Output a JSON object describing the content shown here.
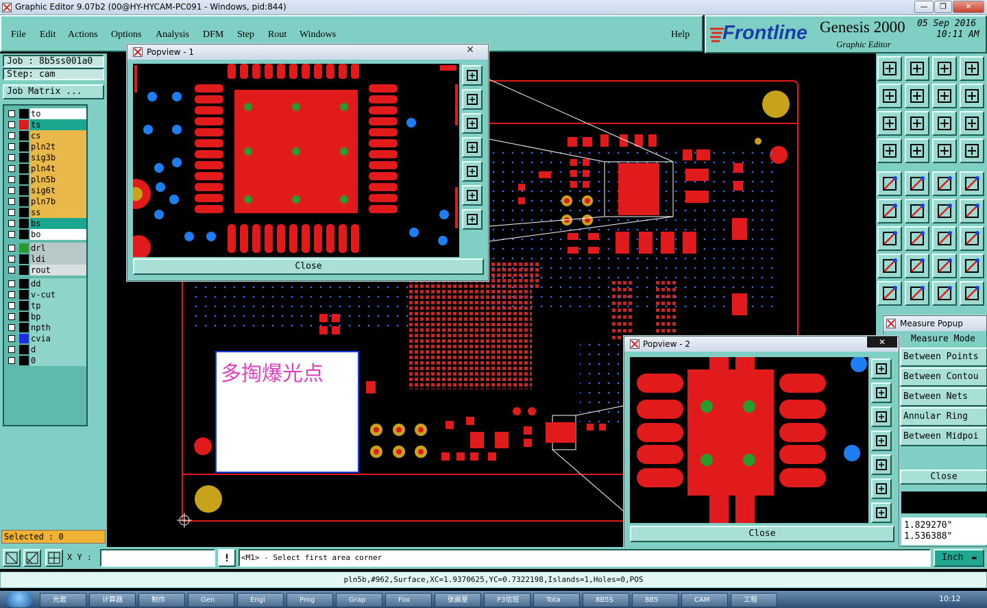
{
  "window": {
    "title": "Graphic Editor 9.07b2 (00@HY-HYCAM-PC091 - Windows, pid:844)"
  },
  "menu": {
    "items": [
      "File",
      "Edit",
      "Actions",
      "Options",
      "Analysis",
      "DFM",
      "Step",
      "Rout",
      "Windows"
    ],
    "help": "Help"
  },
  "brand": {
    "logo": "Frontline",
    "product": "Genesis 2000",
    "subtitle": "Graphic Editor",
    "date": "05 Sep 2016",
    "time": "10:11 AM"
  },
  "job": {
    "job_label": "Job : 8b5ss001a0",
    "step_label": "Step: cam",
    "matrix_button": "Job Matrix ..."
  },
  "layers_group1": [
    {
      "name": "to",
      "color": "#ffffff",
      "swatch": "#000000"
    },
    {
      "name": "ts",
      "color": "#1aa68f",
      "swatch": "#e11b1b"
    },
    {
      "name": "cs",
      "color": "#e8b84a",
      "swatch": "#000000"
    },
    {
      "name": "pln2t",
      "color": "#e8b84a",
      "swatch": "#000000"
    },
    {
      "name": "sig3b",
      "color": "#e8b84a",
      "swatch": "#000000"
    },
    {
      "name": "pln4t",
      "color": "#e8b84a",
      "swatch": "#000000"
    },
    {
      "name": "pln5b",
      "color": "#e8b84a",
      "swatch": "#000000"
    },
    {
      "name": "sig6t",
      "color": "#e8b84a",
      "swatch": "#000000"
    },
    {
      "name": "pln7b",
      "color": "#e8b84a",
      "swatch": "#000000"
    },
    {
      "name": "ss",
      "color": "#e8b84a",
      "swatch": "#000000"
    },
    {
      "name": "bs",
      "color": "#1aa68f",
      "swatch": "#000000"
    },
    {
      "name": "bo",
      "color": "#ffffff",
      "swatch": "#000000"
    }
  ],
  "layers_group2": [
    {
      "name": "drl",
      "color": "#b8c8c8",
      "swatch": "#2a9a2a"
    },
    {
      "name": "ldi",
      "color": "#b8c8c8",
      "swatch": "#000000"
    },
    {
      "name": "rout",
      "color": "#d8e0e0",
      "swatch": "#000000"
    }
  ],
  "layers_group3": [
    {
      "name": "dd",
      "color": "#8fd4ca",
      "swatch": "#000000"
    },
    {
      "name": "v-cut",
      "color": "#8fd4ca",
      "swatch": "#000000"
    },
    {
      "name": "tp",
      "color": "#8fd4ca",
      "swatch": "#000000"
    },
    {
      "name": "bp",
      "color": "#8fd4ca",
      "swatch": "#000000"
    },
    {
      "name": "npth",
      "color": "#8fd4ca",
      "swatch": "#000000"
    },
    {
      "name": "cvia",
      "color": "#8fd4ca",
      "swatch": "#1a2ee0"
    },
    {
      "name": "d",
      "color": "#8fd4ca",
      "swatch": "#000000"
    },
    {
      "name": "0",
      "color": "#8fd4ca",
      "swatch": "#000000"
    }
  ],
  "selected": "Selected : 0",
  "canvas": {
    "annotation_text": "多掏爆光点"
  },
  "popview1": {
    "title": "Popview - 1",
    "close_label": "Close"
  },
  "popview2": {
    "title": "Popview - 2",
    "close_label": "Close"
  },
  "measure": {
    "title": "Measure Popup",
    "mode_label": "Measure Mode",
    "modes": [
      "Between Points",
      "Between Contou",
      "Between Nets",
      "Annular Ring",
      "Between Midpoi"
    ],
    "close_label": "Close",
    "x_value": "1.829270\"",
    "y_value": "1.536388\""
  },
  "command": {
    "xy_label": "X Y :",
    "xy_value": "",
    "prompt": "<M1> - Select first area corner",
    "unit": "Inch"
  },
  "status_line": "pln5b,#962,Surface,XC=1.9370625,YC=0.7322198,Islands=1,Holes=0,POS",
  "taskbar": {
    "items": [
      "光套",
      "计算器",
      "制作",
      "Gen",
      "Engi",
      "Prog",
      "Grap",
      "Fox",
      "张晨星",
      "P3信班",
      "Tota",
      "8B5S",
      "8B5",
      "CAM",
      "工程"
    ],
    "clock": "10:12"
  },
  "colors": {
    "teal": "#7fcfc4",
    "copper": "#e11b1b",
    "drill": "#2a9a2a",
    "via": "#1e7ff5",
    "pad_gold": "#c9a21b"
  }
}
